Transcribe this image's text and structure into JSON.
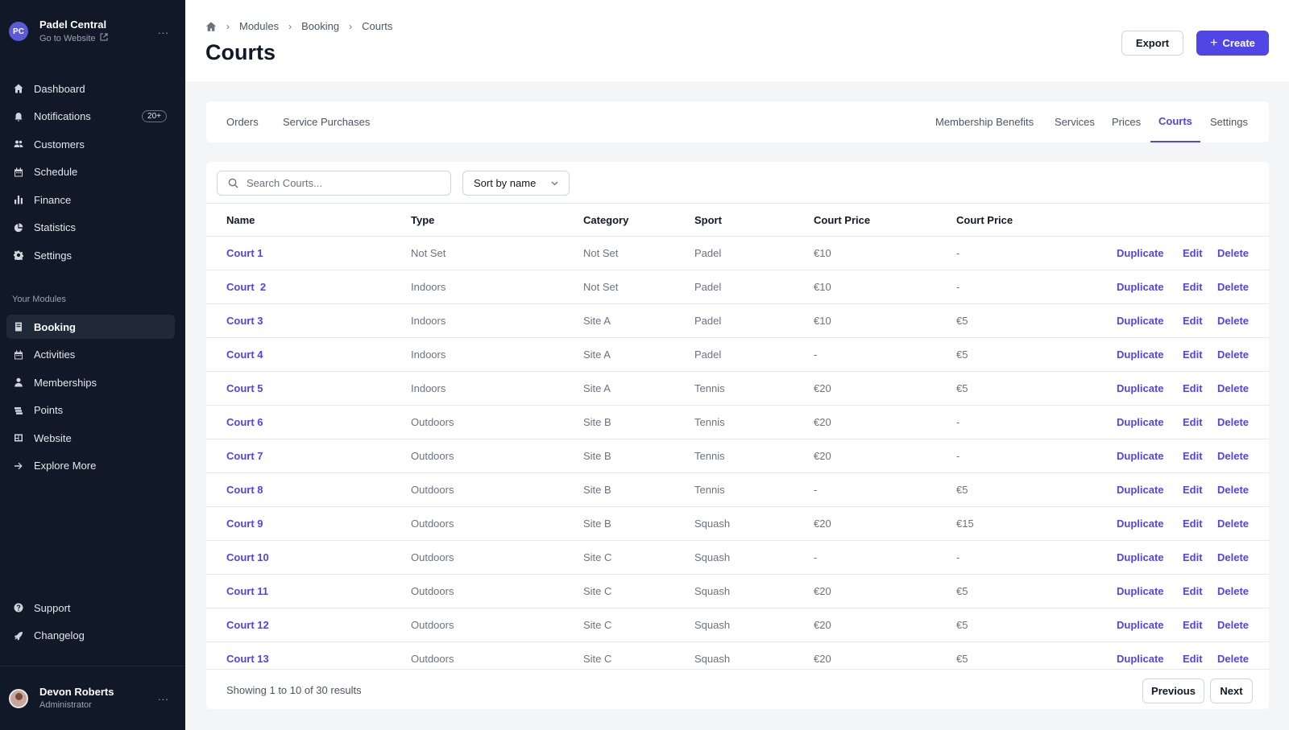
{
  "org": {
    "initials": "PC",
    "name": "Padel Central",
    "link_label": "Go to Website",
    "more": "..."
  },
  "sidebar": {
    "items": [
      {
        "label": "Dashboard",
        "icon": "home-icon"
      },
      {
        "label": "Notifications",
        "icon": "bell-icon",
        "badge": "20+"
      },
      {
        "label": "Customers",
        "icon": "users-icon"
      },
      {
        "label": "Schedule",
        "icon": "calendar-icon"
      },
      {
        "label": "Finance",
        "icon": "bar-chart-icon"
      },
      {
        "label": "Statistics",
        "icon": "pie-chart-icon"
      },
      {
        "label": "Settings",
        "icon": "gear-icon"
      }
    ],
    "modules_label": "Your Modules",
    "modules": [
      {
        "label": "Booking",
        "icon": "book-icon",
        "active": true
      },
      {
        "label": "Activities",
        "icon": "calendar-icon"
      },
      {
        "label": "Memberships",
        "icon": "user-icon"
      },
      {
        "label": "Points",
        "icon": "stack-icon"
      },
      {
        "label": "Website",
        "icon": "globe-icon"
      },
      {
        "label": "Explore More",
        "icon": "arrow-right-icon"
      }
    ],
    "bottom": [
      {
        "label": "Support",
        "icon": "help-icon"
      },
      {
        "label": "Changelog",
        "icon": "rocket-icon"
      }
    ]
  },
  "user": {
    "name": "Devon Roberts",
    "role": "Administrator",
    "more": "..."
  },
  "header": {
    "breadcrumb": [
      "Modules",
      "Booking",
      "Courts"
    ],
    "title": "Courts",
    "export_label": "Export",
    "create_label": "Create"
  },
  "tabs": {
    "left": [
      "Orders",
      "Service Purchases"
    ],
    "right": [
      "Membership Benefits",
      "Services",
      "Prices",
      "Courts",
      "Settings"
    ],
    "active": "Courts"
  },
  "toolbar": {
    "search_placeholder": "Search Courts...",
    "sort_label": "Sort by name"
  },
  "table": {
    "columns": [
      "Name",
      "Type",
      "Category",
      "Sport",
      "Court Price",
      "Court Price"
    ],
    "actions": [
      "Duplicate",
      "Edit",
      "Delete"
    ],
    "rows": [
      [
        "Court 1",
        "Not Set",
        "Not Set",
        "Padel",
        "€10",
        "-"
      ],
      [
        "Court  2",
        "Indoors",
        "Not Set",
        "Padel",
        "€10",
        "-"
      ],
      [
        "Court 3",
        "Indoors",
        "Site A",
        "Padel",
        "€10",
        "€5"
      ],
      [
        "Court 4",
        "Indoors",
        "Site A",
        "Padel",
        "-",
        "€5"
      ],
      [
        "Court 5",
        "Indoors",
        "Site A",
        "Tennis",
        "€20",
        "€5"
      ],
      [
        "Court 6",
        "Outdoors",
        "Site B",
        "Tennis",
        "€20",
        "-"
      ],
      [
        "Court 7",
        "Outdoors",
        "Site B",
        "Tennis",
        "€20",
        "-"
      ],
      [
        "Court 8",
        "Outdoors",
        "Site B",
        "Tennis",
        "-",
        "€5"
      ],
      [
        "Court 9",
        "Outdoors",
        "Site B",
        "Squash",
        "€20",
        "€15"
      ],
      [
        "Court 10",
        "Outdoors",
        "Site C",
        "Squash",
        "-",
        "-"
      ],
      [
        "Court 11",
        "Outdoors",
        "Site C",
        "Squash",
        "€20",
        "€5"
      ],
      [
        "Court 12",
        "Outdoors",
        "Site C",
        "Squash",
        "€20",
        "€5"
      ],
      [
        "Court 13",
        "Outdoors",
        "Site C",
        "Squash",
        "€20",
        "€5"
      ]
    ]
  },
  "pagination": {
    "summary": "Showing 1 to 10 of 30 results",
    "previous_label": "Previous",
    "next_label": "Next"
  },
  "colors": {
    "accent": "#4f46e5",
    "sidebar_bg": "#111827",
    "page_bg": "#f4f5f7"
  }
}
